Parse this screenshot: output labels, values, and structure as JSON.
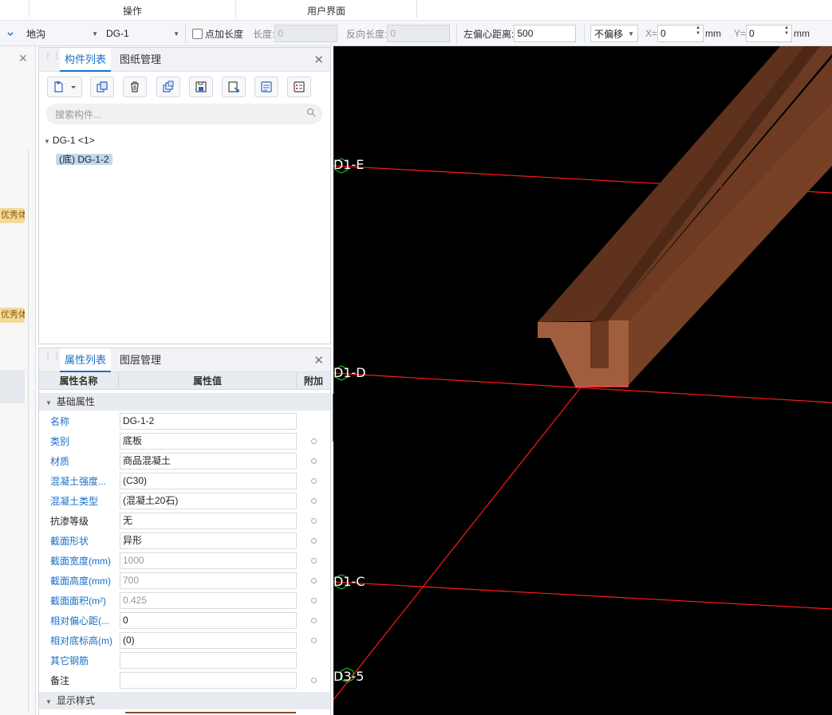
{
  "ribbon": {
    "groups": [
      "操作",
      "用户界面"
    ]
  },
  "toolbar": {
    "type_combo": "地沟",
    "name_combo": "DG-1",
    "point_length_checkbox": "点加长度",
    "length_label": "长度:",
    "length_value": "0",
    "reverse_length_label": "反向长度:",
    "reverse_length_value": "0",
    "left_offset_label": "左偏心距离:",
    "left_offset_value": "500",
    "offset_mode": "不偏移",
    "x_label": "X=",
    "x_value": "0",
    "x_unit": "mm",
    "y_label": "Y=",
    "y_value": "0",
    "y_unit": "mm"
  },
  "left_strip": {
    "tags": [
      "优秀体验",
      "优秀体验"
    ]
  },
  "component_panel": {
    "tabs": [
      "构件列表",
      "图纸管理"
    ],
    "search_placeholder": "搜索构件...",
    "tree": {
      "parent": "DG-1 <1>",
      "child": "(底) DG-1-2"
    }
  },
  "property_panel": {
    "tabs": [
      "属性列表",
      "图层管理"
    ],
    "headers": [
      "属性名称",
      "属性值",
      "附加"
    ],
    "section_basic": "基础属性",
    "section_display": "显示样式",
    "rows": [
      {
        "name": "名称",
        "value": "DG-1-2",
        "blue": true,
        "gray": false,
        "dot": false
      },
      {
        "name": "类别",
        "value": "底板",
        "blue": true,
        "gray": false,
        "dot": true
      },
      {
        "name": "材质",
        "value": "商品混凝土",
        "blue": true,
        "gray": false,
        "dot": true
      },
      {
        "name": "混凝土强度...",
        "value": "(C30)",
        "blue": true,
        "gray": false,
        "dot": true
      },
      {
        "name": "混凝土类型",
        "value": "(混凝土20石)",
        "blue": true,
        "gray": false,
        "dot": true
      },
      {
        "name": "抗渗等级",
        "value": "无",
        "blue": false,
        "gray": false,
        "dot": true
      },
      {
        "name": "截面形状",
        "value": "异形",
        "blue": true,
        "gray": false,
        "dot": true
      },
      {
        "name": "截面宽度(mm)",
        "value": "1000",
        "blue": true,
        "gray": true,
        "dot": true
      },
      {
        "name": "截面高度(mm)",
        "value": "700",
        "blue": true,
        "gray": true,
        "dot": true
      },
      {
        "name": "截面面积(m²)",
        "value": "0.425",
        "blue": true,
        "gray": true,
        "dot": true
      },
      {
        "name": "相对偏心距(...",
        "value": "0",
        "blue": true,
        "gray": false,
        "dot": true
      },
      {
        "name": "相对底标高(m)",
        "value": "(0)",
        "blue": true,
        "gray": false,
        "dot": true
      },
      {
        "name": "其它钢筋",
        "value": "",
        "blue": true,
        "gray": false,
        "dot": false
      },
      {
        "name": "备注",
        "value": "",
        "blue": false,
        "gray": false,
        "dot": true
      }
    ]
  },
  "viewport": {
    "axis_labels": [
      "D1-E",
      "D1-D",
      "D1-C",
      "D3-5"
    ],
    "colors": {
      "background": "#000000",
      "grid_line": "#ff1a1a",
      "member": "#8a4a2a",
      "axis_marker": "#19c119"
    }
  },
  "colors": {
    "accent": "#1a6fc9",
    "tag": "#f3d99a"
  }
}
